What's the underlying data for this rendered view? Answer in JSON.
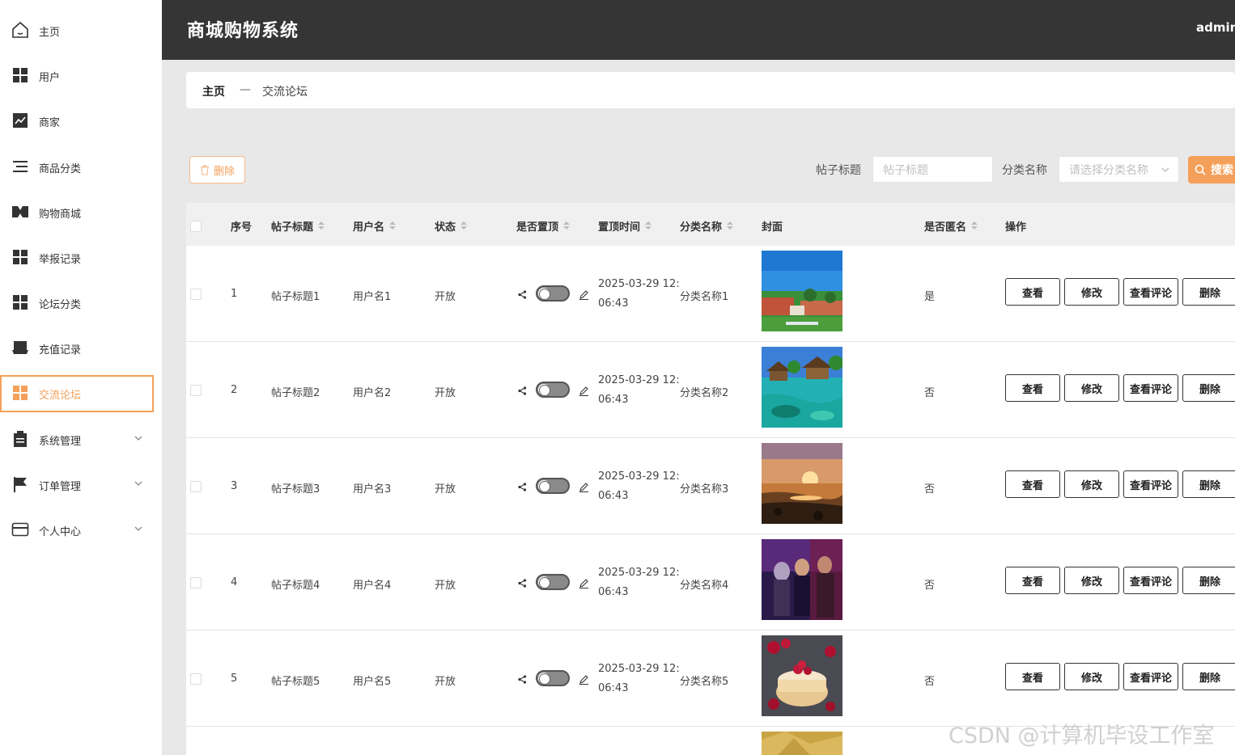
{
  "sidebar": {
    "items": [
      {
        "label": "主页",
        "icon": "home-icon"
      },
      {
        "label": "用户",
        "icon": "grid-icon"
      },
      {
        "label": "商家",
        "icon": "chart-icon"
      },
      {
        "label": "商品分类",
        "icon": "list-icon"
      },
      {
        "label": "购物商城",
        "icon": "shop-icon"
      },
      {
        "label": "举报记录",
        "icon": "grid-icon"
      },
      {
        "label": "论坛分类",
        "icon": "grid-icon"
      },
      {
        "label": "充值记录",
        "icon": "store-icon"
      },
      {
        "label": "交流论坛",
        "icon": "grid-icon",
        "active": true
      },
      {
        "label": "系统管理",
        "icon": "clipboard-icon",
        "expandable": true
      },
      {
        "label": "订单管理",
        "icon": "flag-icon",
        "expandable": true
      },
      {
        "label": "个人中心",
        "icon": "card-icon",
        "expandable": true
      }
    ]
  },
  "header": {
    "title": "商城购物系统",
    "user": "admin"
  },
  "breadcrumb": {
    "home": "主页",
    "separator": "—",
    "current": "交流论坛"
  },
  "toolbar": {
    "delete_label": "删除",
    "title_label": "帖子标题",
    "title_placeholder": "帖子标题",
    "category_label": "分类名称",
    "category_placeholder": "请选择分类名称",
    "search_label": "搜索"
  },
  "table": {
    "columns": [
      "序号",
      "帖子标题",
      "用户名",
      "状态",
      "是否置顶",
      "置顶时间",
      "分类名称",
      "封面",
      "是否匿名",
      "操作"
    ],
    "rows": [
      {
        "index": "1",
        "title": "帖子标题1",
        "user": "用户名1",
        "status": "开放",
        "time_line1": "2025-03-29 12:",
        "time_line2": "06:43",
        "category": "分类名称1",
        "anonymous": "是"
      },
      {
        "index": "2",
        "title": "帖子标题2",
        "user": "用户名2",
        "status": "开放",
        "time_line1": "2025-03-29 12:",
        "time_line2": "06:43",
        "category": "分类名称2",
        "anonymous": "否"
      },
      {
        "index": "3",
        "title": "帖子标题3",
        "user": "用户名3",
        "status": "开放",
        "time_line1": "2025-03-29 12:",
        "time_line2": "06:43",
        "category": "分类名称3",
        "anonymous": "否"
      },
      {
        "index": "4",
        "title": "帖子标题4",
        "user": "用户名4",
        "status": "开放",
        "time_line1": "2025-03-29 12:",
        "time_line2": "06:43",
        "category": "分类名称4",
        "anonymous": "否"
      },
      {
        "index": "5",
        "title": "帖子标题5",
        "user": "用户名5",
        "status": "开放",
        "time_line1": "2025-03-29 12:",
        "time_line2": "06:43",
        "category": "分类名称5",
        "anonymous": "否"
      }
    ],
    "actions": {
      "view": "查看",
      "edit": "修改",
      "comments": "查看评论",
      "delete": "删除"
    }
  },
  "watermark": "CSDN @计算机毕设工作室",
  "colors": {
    "accent": "#f5a05a",
    "header_bg": "#353535",
    "content_bg": "#e8e8e8"
  }
}
